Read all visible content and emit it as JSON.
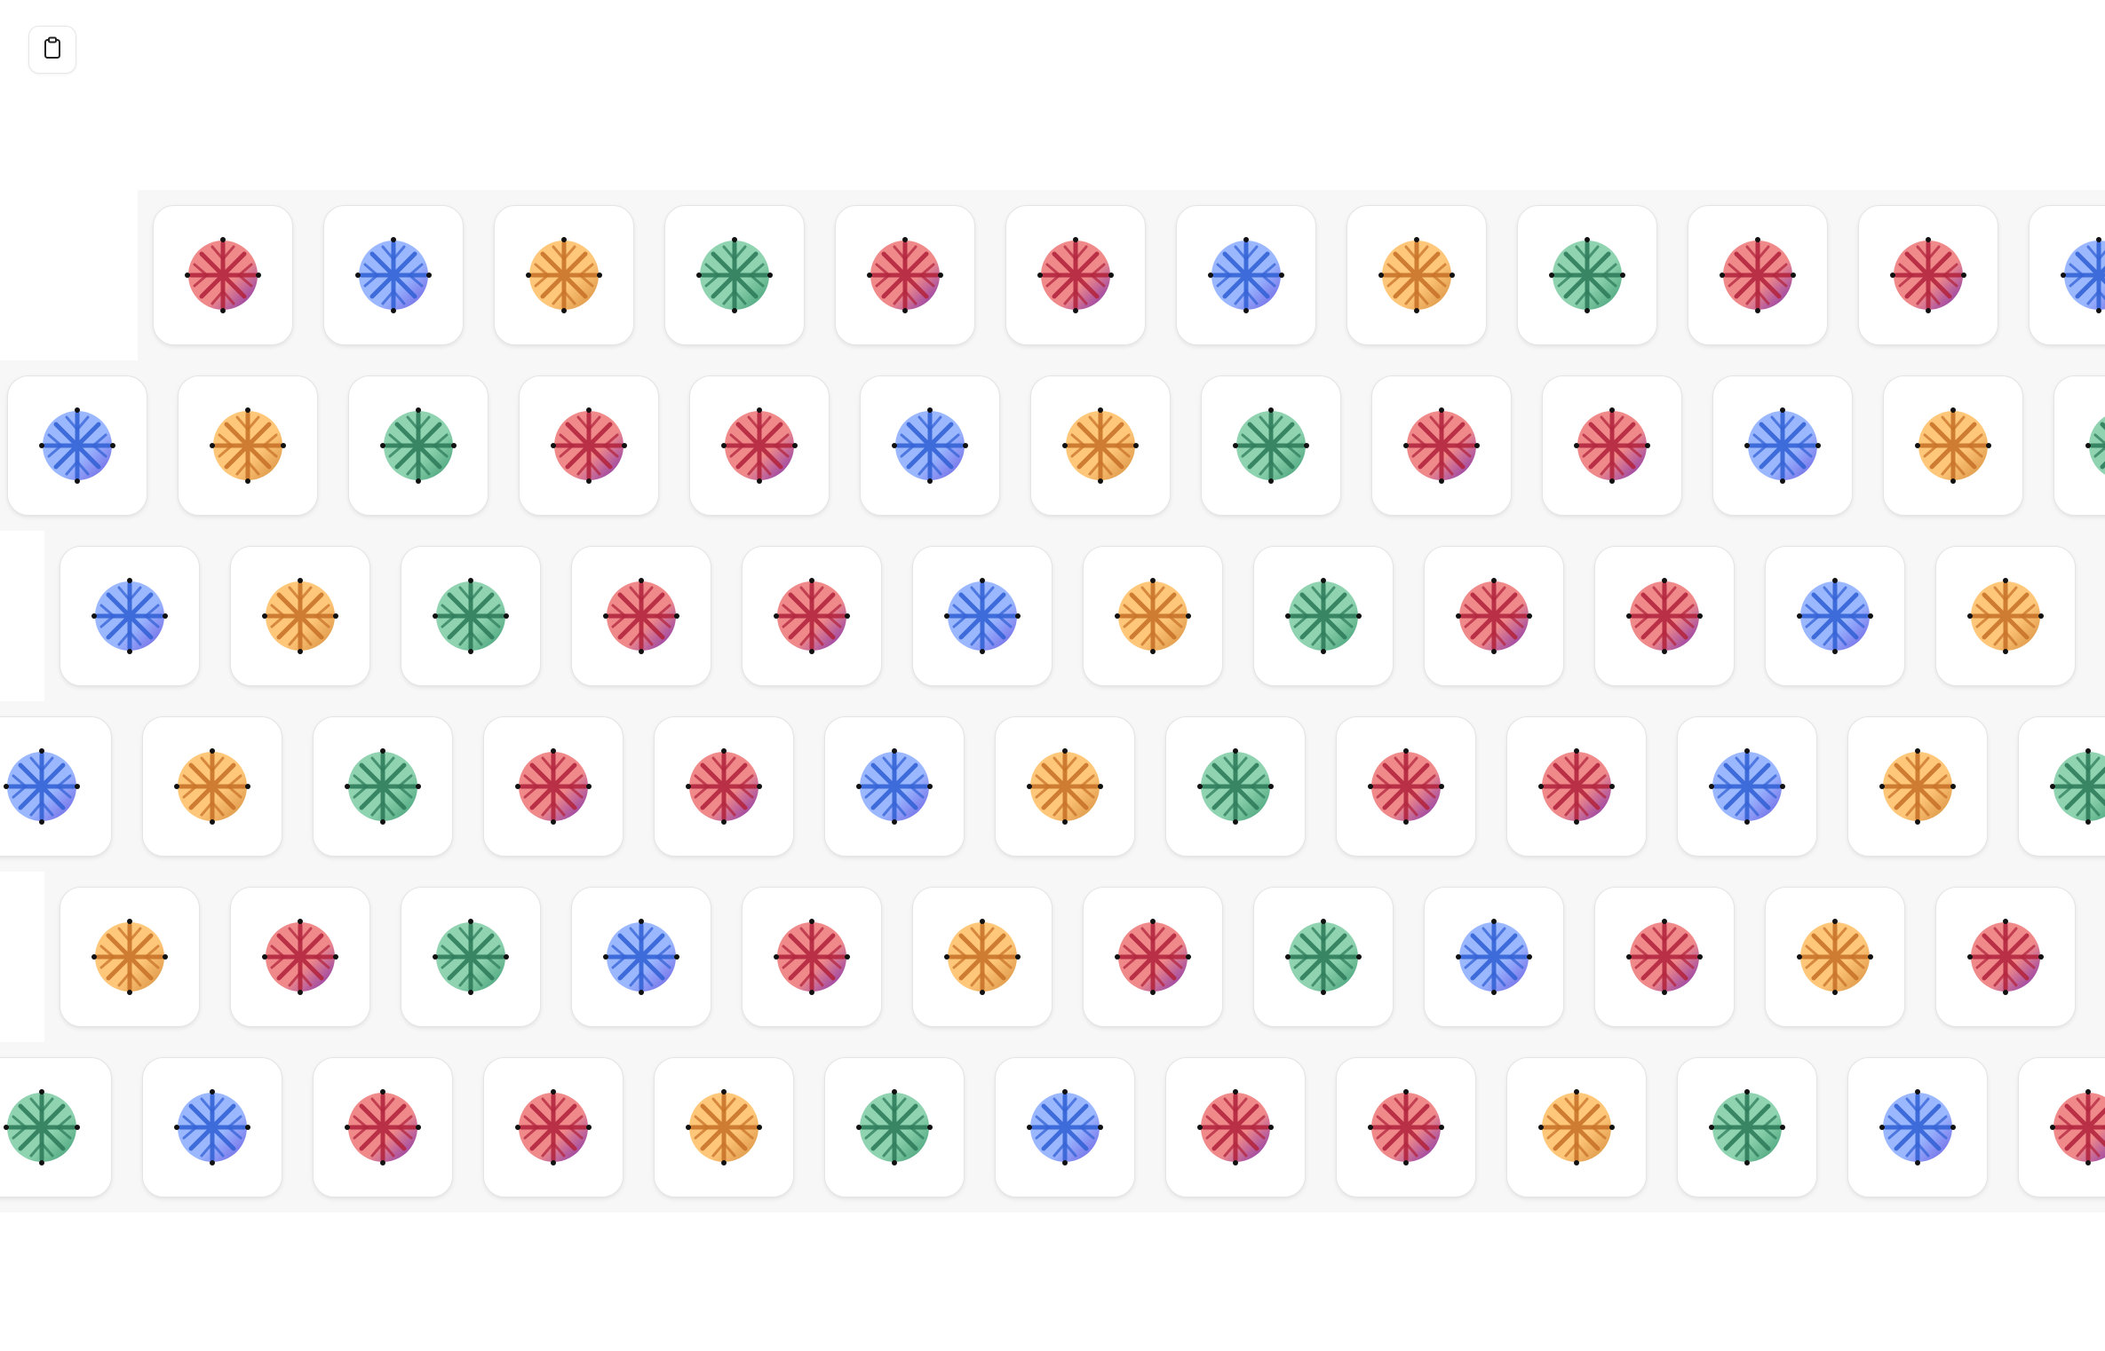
{
  "toolbar": {
    "clipboard_button": {
      "icon": "clipboard-icon"
    }
  },
  "palette": {
    "red": {
      "light": "#f08a8a",
      "dark": "#b3263f",
      "accent": "#7a2bb0"
    },
    "blue": {
      "light": "#9bb8ff",
      "dark": "#3563d6",
      "accent": "#6a5ae0"
    },
    "orange": {
      "light": "#ffc77a",
      "dark": "#c9742a",
      "accent": "#d48a3a"
    },
    "green": {
      "light": "#8fd3b0",
      "dark": "#2f7d5c",
      "accent": "#3a9a70"
    }
  },
  "icon_name": "asterisk-wheel-icon",
  "rows": [
    [
      "red",
      "blue",
      "orange",
      "green",
      "red",
      "red",
      "blue",
      "orange",
      "green",
      "red",
      "red",
      "blue"
    ],
    [
      "blue",
      "orange",
      "green",
      "red",
      "red",
      "blue",
      "orange",
      "green",
      "red",
      "red",
      "blue",
      "orange",
      "green"
    ],
    [
      "blue",
      "orange",
      "green",
      "red",
      "red",
      "blue",
      "orange",
      "green",
      "red",
      "red",
      "blue",
      "orange"
    ],
    [
      "blue",
      "orange",
      "green",
      "red",
      "red",
      "blue",
      "orange",
      "green",
      "red",
      "red",
      "blue",
      "orange",
      "green"
    ],
    [
      "orange",
      "red",
      "green",
      "blue",
      "red",
      "orange",
      "red",
      "green",
      "blue",
      "red",
      "orange",
      "red"
    ],
    [
      "green",
      "blue",
      "red",
      "red",
      "orange",
      "green",
      "blue",
      "red",
      "red",
      "orange",
      "green",
      "blue",
      "red"
    ]
  ]
}
